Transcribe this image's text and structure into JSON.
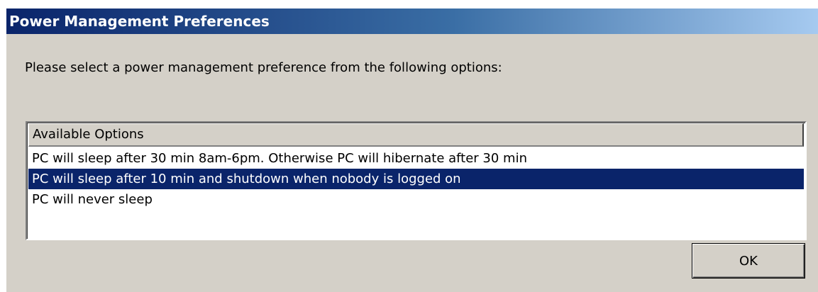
{
  "window": {
    "title": "Power Management Preferences"
  },
  "prompt": "Please select a power management preference from the following options:",
  "list": {
    "header": "Available Options",
    "items": [
      "PC will sleep after 30 min 8am-6pm. Otherwise PC will hibernate after 30 min",
      "PC will sleep after 10 min and shutdown when nobody is logged on",
      "PC will never sleep"
    ],
    "selected_index": 1
  },
  "buttons": {
    "ok_label": "OK"
  },
  "colors": {
    "dialog_background": "#d4d0c8",
    "selection": "#0a246a",
    "titlebar_start": "#0a246a",
    "titlebar_end": "#a6caf0"
  }
}
